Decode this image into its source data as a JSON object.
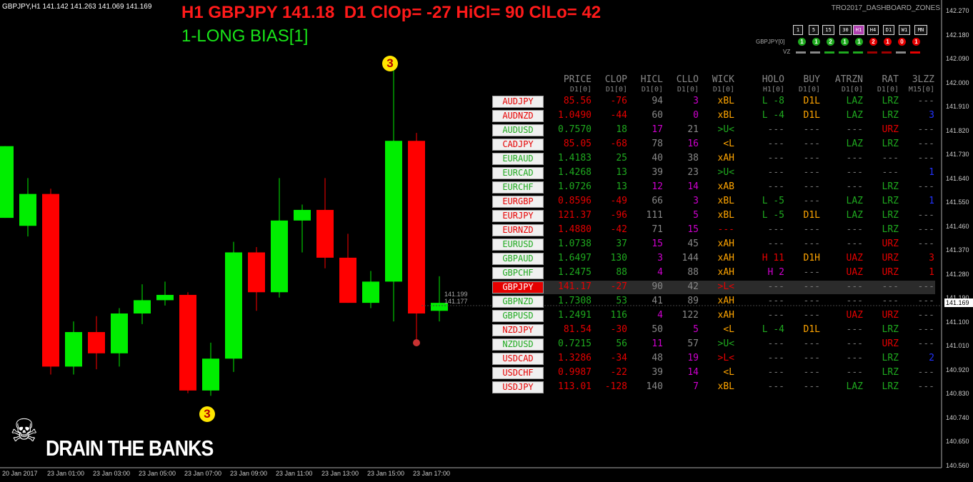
{
  "symbol_line": "GBPJPY,H1  141.142 141.263 141.069 141.169",
  "headline1": "H1 GBPJPY 141.18  D1 ClOp= -27 HiCl= 90 ClLo= 42",
  "headline2": "1-LONG BIAS[1]",
  "corner_label": "TRO2017_DASHBOARD_ZONES",
  "brand_text": "DRAIN THE BANKS",
  "skull_icon": "☠",
  "timeframes": [
    {
      "label": "1",
      "selected": false
    },
    {
      "label": "5",
      "selected": false
    },
    {
      "label": "15",
      "selected": false
    },
    {
      "label": "30",
      "selected": false
    },
    {
      "label": "H1",
      "selected": true
    },
    {
      "label": "H4",
      "selected": false
    },
    {
      "label": "D1",
      "selected": false
    },
    {
      "label": "W1",
      "selected": false
    },
    {
      "label": "MN",
      "selected": false
    }
  ],
  "tf_row_label": "GBPJPY[0]",
  "tf_circles": [
    {
      "v": "1",
      "c": "#1faa1f"
    },
    {
      "v": "1",
      "c": "#1faa1f"
    },
    {
      "v": "2",
      "c": "#1faa1f"
    },
    {
      "v": "1",
      "c": "#1faa1f"
    },
    {
      "v": "1",
      "c": "#1faa1f"
    },
    {
      "v": "2",
      "c": "#e60000"
    },
    {
      "v": "1",
      "c": "#e60000"
    },
    {
      "v": "0",
      "c": "#e60000"
    },
    {
      "v": "1",
      "c": "#e60000"
    }
  ],
  "vz_label": "VZ",
  "vz_colors": [
    "#888",
    "#888",
    "#1faa1f",
    "#1faa1f",
    "#1faa1f",
    "#a00000",
    "#a00000",
    "#888",
    "#e60000"
  ],
  "headers": [
    {
      "h": "PRICE",
      "s": "D1[0]"
    },
    {
      "h": "CLOP",
      "s": "D1[0]"
    },
    {
      "h": "HICL",
      "s": "D1[0]"
    },
    {
      "h": "CLLO",
      "s": "D1[0]"
    },
    {
      "h": "WICK",
      "s": "D1[0]"
    },
    {
      "h": "HOLO",
      "s": "H1[0]"
    },
    {
      "h": "BUY",
      "s": "D1[0]"
    },
    {
      "h": "ATRZN",
      "s": "D1[0]"
    },
    {
      "h": "RAT",
      "s": "D1[0]"
    },
    {
      "h": "3LZZ",
      "s": "M15[0]"
    }
  ],
  "rows": [
    {
      "pair": "AUDJPY",
      "pc": "#e60000",
      "price": "85.56",
      "clop": "-76",
      "hicl": "94",
      "cllo": "3",
      "wick": "xBL",
      "holo": "L -8",
      "buy": "D1L",
      "atr": "LAZ",
      "rat": "LRZ",
      "lzz": "---",
      "cc": [
        "#e60000",
        "#e60000",
        "#888",
        "#d000d0",
        "#ffa500",
        "#1faa1f",
        "#ffa500",
        "#1faa1f",
        "#1faa1f",
        "#777"
      ]
    },
    {
      "pair": "AUDNZD",
      "pc": "#e60000",
      "price": "1.0490",
      "clop": "-44",
      "hicl": "60",
      "cllo": "0",
      "wick": "xBL",
      "holo": "L -4",
      "buy": "D1L",
      "atr": "LAZ",
      "rat": "LRZ",
      "lzz": "3",
      "cc": [
        "#e60000",
        "#e60000",
        "#888",
        "#d000d0",
        "#ffa500",
        "#1faa1f",
        "#ffa500",
        "#1faa1f",
        "#1faa1f",
        "#2233ff"
      ]
    },
    {
      "pair": "AUDUSD",
      "pc": "#1faa1f",
      "price": "0.7570",
      "clop": "18",
      "hicl": "17",
      "cllo": "21",
      "wick": ">U<",
      "holo": "---",
      "buy": "---",
      "atr": "---",
      "rat": "URZ",
      "lzz": "---",
      "cc": [
        "#1faa1f",
        "#1faa1f",
        "#d000d0",
        "#888",
        "#1faa1f",
        "#777",
        "#777",
        "#777",
        "#e60000",
        "#777"
      ]
    },
    {
      "pair": "CADJPY",
      "pc": "#e60000",
      "price": "85.05",
      "clop": "-68",
      "hicl": "78",
      "cllo": "16",
      "wick": "<L",
      "holo": "---",
      "buy": "---",
      "atr": "LAZ",
      "rat": "LRZ",
      "lzz": "---",
      "cc": [
        "#e60000",
        "#e60000",
        "#888",
        "#d000d0",
        "#ffa500",
        "#777",
        "#777",
        "#1faa1f",
        "#1faa1f",
        "#777"
      ]
    },
    {
      "pair": "EURAUD",
      "pc": "#1faa1f",
      "price": "1.4183",
      "clop": "25",
      "hicl": "40",
      "cllo": "38",
      "wick": "xAH",
      "holo": "---",
      "buy": "---",
      "atr": "---",
      "rat": "---",
      "lzz": "---",
      "cc": [
        "#1faa1f",
        "#1faa1f",
        "#888",
        "#888",
        "#ffa500",
        "#777",
        "#777",
        "#777",
        "#777",
        "#777"
      ]
    },
    {
      "pair": "EURCAD",
      "pc": "#1faa1f",
      "price": "1.4268",
      "clop": "13",
      "hicl": "39",
      "cllo": "23",
      "wick": ">U<",
      "holo": "---",
      "buy": "---",
      "atr": "---",
      "rat": "---",
      "lzz": "1",
      "cc": [
        "#1faa1f",
        "#1faa1f",
        "#888",
        "#888",
        "#1faa1f",
        "#777",
        "#777",
        "#777",
        "#777",
        "#2233ff"
      ]
    },
    {
      "pair": "EURCHF",
      "pc": "#1faa1f",
      "price": "1.0726",
      "clop": "13",
      "hicl": "12",
      "cllo": "14",
      "wick": "xAB",
      "holo": "---",
      "buy": "---",
      "atr": "---",
      "rat": "LRZ",
      "lzz": "---",
      "cc": [
        "#1faa1f",
        "#1faa1f",
        "#d000d0",
        "#d000d0",
        "#ffa500",
        "#777",
        "#777",
        "#777",
        "#1faa1f",
        "#777"
      ]
    },
    {
      "pair": "EURGBP",
      "pc": "#e60000",
      "price": "0.8596",
      "clop": "-49",
      "hicl": "66",
      "cllo": "3",
      "wick": "xBL",
      "holo": "L -5",
      "buy": "---",
      "atr": "LAZ",
      "rat": "LRZ",
      "lzz": "1",
      "cc": [
        "#e60000",
        "#e60000",
        "#888",
        "#d000d0",
        "#ffa500",
        "#1faa1f",
        "#777",
        "#1faa1f",
        "#1faa1f",
        "#2233ff"
      ]
    },
    {
      "pair": "EURJPY",
      "pc": "#e60000",
      "price": "121.37",
      "clop": "-96",
      "hicl": "111",
      "cllo": "5",
      "wick": "xBL",
      "holo": "L -5",
      "buy": "D1L",
      "atr": "LAZ",
      "rat": "LRZ",
      "lzz": "---",
      "cc": [
        "#e60000",
        "#e60000",
        "#888",
        "#d000d0",
        "#ffa500",
        "#1faa1f",
        "#ffa500",
        "#1faa1f",
        "#1faa1f",
        "#777"
      ]
    },
    {
      "pair": "EURNZD",
      "pc": "#e60000",
      "price": "1.4880",
      "clop": "-42",
      "hicl": "71",
      "cllo": "15",
      "wick": "---",
      "holo": "---",
      "buy": "---",
      "atr": "---",
      "rat": "LRZ",
      "lzz": "---",
      "cc": [
        "#e60000",
        "#e60000",
        "#888",
        "#d000d0",
        "#e60000",
        "#777",
        "#777",
        "#777",
        "#1faa1f",
        "#777"
      ]
    },
    {
      "pair": "EURUSD",
      "pc": "#1faa1f",
      "price": "1.0738",
      "clop": "37",
      "hicl": "15",
      "cllo": "45",
      "wick": "xAH",
      "holo": "---",
      "buy": "---",
      "atr": "---",
      "rat": "URZ",
      "lzz": "---",
      "cc": [
        "#1faa1f",
        "#1faa1f",
        "#d000d0",
        "#888",
        "#ffa500",
        "#777",
        "#777",
        "#777",
        "#e60000",
        "#777"
      ]
    },
    {
      "pair": "GBPAUD",
      "pc": "#1faa1f",
      "price": "1.6497",
      "clop": "130",
      "hicl": "3",
      "cllo": "144",
      "wick": "xAH",
      "holo": "H 11",
      "buy": "D1H",
      "atr": "UAZ",
      "rat": "URZ",
      "lzz": "3",
      "cc": [
        "#1faa1f",
        "#1faa1f",
        "#d000d0",
        "#888",
        "#ffa500",
        "#e60000",
        "#ffa500",
        "#e60000",
        "#e60000",
        "#e60000"
      ]
    },
    {
      "pair": "GBPCHF",
      "pc": "#1faa1f",
      "price": "1.2475",
      "clop": "88",
      "hicl": "4",
      "cllo": "88",
      "wick": "xAH",
      "holo": "H 2",
      "buy": "---",
      "atr": "UAZ",
      "rat": "URZ",
      "lzz": "1",
      "cc": [
        "#1faa1f",
        "#1faa1f",
        "#d000d0",
        "#888",
        "#ffa500",
        "#d000d0",
        "#777",
        "#e60000",
        "#e60000",
        "#e60000"
      ]
    },
    {
      "pair": "GBPJPY",
      "pc": "#e60000",
      "price": "141.17",
      "clop": "-27",
      "hicl": "90",
      "cllo": "42",
      "wick": ">L<",
      "holo": "---",
      "buy": "---",
      "atr": "---",
      "rat": "---",
      "lzz": "---",
      "cc": [
        "#e60000",
        "#e60000",
        "#888",
        "#888",
        "#e60000",
        "#777",
        "#777",
        "#777",
        "#777",
        "#777"
      ]
    },
    {
      "pair": "GBPNZD",
      "pc": "#1faa1f",
      "price": "1.7308",
      "clop": "53",
      "hicl": "41",
      "cllo": "89",
      "wick": "xAH",
      "holo": "---",
      "buy": "---",
      "atr": "---",
      "rat": "---",
      "lzz": "---",
      "cc": [
        "#1faa1f",
        "#1faa1f",
        "#888",
        "#888",
        "#ffa500",
        "#777",
        "#777",
        "#777",
        "#777",
        "#777"
      ]
    },
    {
      "pair": "GBPUSD",
      "pc": "#1faa1f",
      "price": "1.2491",
      "clop": "116",
      "hicl": "4",
      "cllo": "122",
      "wick": "xAH",
      "holo": "---",
      "buy": "---",
      "atr": "UAZ",
      "rat": "URZ",
      "lzz": "---",
      "cc": [
        "#1faa1f",
        "#1faa1f",
        "#d000d0",
        "#888",
        "#ffa500",
        "#777",
        "#777",
        "#e60000",
        "#e60000",
        "#777"
      ]
    },
    {
      "pair": "NZDJPY",
      "pc": "#e60000",
      "price": "81.54",
      "clop": "-30",
      "hicl": "50",
      "cllo": "5",
      "wick": "<L",
      "holo": "L -4",
      "buy": "D1L",
      "atr": "---",
      "rat": "LRZ",
      "lzz": "---",
      "cc": [
        "#e60000",
        "#e60000",
        "#888",
        "#d000d0",
        "#ffa500",
        "#1faa1f",
        "#ffa500",
        "#777",
        "#1faa1f",
        "#777"
      ]
    },
    {
      "pair": "NZDUSD",
      "pc": "#1faa1f",
      "price": "0.7215",
      "clop": "56",
      "hicl": "11",
      "cllo": "57",
      "wick": ">U<",
      "holo": "---",
      "buy": "---",
      "atr": "---",
      "rat": "URZ",
      "lzz": "---",
      "cc": [
        "#1faa1f",
        "#1faa1f",
        "#d000d0",
        "#888",
        "#1faa1f",
        "#777",
        "#777",
        "#777",
        "#e60000",
        "#777"
      ]
    },
    {
      "pair": "USDCAD",
      "pc": "#e60000",
      "price": "1.3286",
      "clop": "-34",
      "hicl": "48",
      "cllo": "19",
      "wick": ">L<",
      "holo": "---",
      "buy": "---",
      "atr": "---",
      "rat": "LRZ",
      "lzz": "2",
      "cc": [
        "#e60000",
        "#e60000",
        "#888",
        "#d000d0",
        "#e60000",
        "#777",
        "#777",
        "#777",
        "#1faa1f",
        "#2233ff"
      ]
    },
    {
      "pair": "USDCHF",
      "pc": "#e60000",
      "price": "0.9987",
      "clop": "-22",
      "hicl": "39",
      "cllo": "14",
      "wick": "<L",
      "holo": "---",
      "buy": "---",
      "atr": "---",
      "rat": "LRZ",
      "lzz": "---",
      "cc": [
        "#e60000",
        "#e60000",
        "#888",
        "#d000d0",
        "#ffa500",
        "#777",
        "#777",
        "#777",
        "#1faa1f",
        "#777"
      ]
    },
    {
      "pair": "USDJPY",
      "pc": "#e60000",
      "price": "113.01",
      "clop": "-128",
      "hicl": "140",
      "cllo": "7",
      "wick": "xBL",
      "holo": "---",
      "buy": "---",
      "atr": "LAZ",
      "rat": "LRZ",
      "lzz": "---",
      "cc": [
        "#e60000",
        "#e60000",
        "#888",
        "#d000d0",
        "#ffa500",
        "#777",
        "#777",
        "#1faa1f",
        "#1faa1f",
        "#777"
      ]
    }
  ],
  "highlight_pair": "GBPJPY",
  "price_axis": [
    "142.270",
    "142.180",
    "142.090",
    "142.000",
    "141.910",
    "141.820",
    "141.730",
    "141.640",
    "141.550",
    "141.460",
    "141.370",
    "141.280",
    "141.190",
    "141.100",
    "141.010",
    "140.920",
    "140.830",
    "140.740",
    "140.650",
    "140.560"
  ],
  "current_price": "141.169",
  "bid_tag": "141.199",
  "ask_tag": "141.177",
  "time_axis": [
    "20 Jan 2017",
    "23 Jan 01:00",
    "23 Jan 03:00",
    "23 Jan 05:00",
    "23 Jan 07:00",
    "23 Jan 09:00",
    "23 Jan 11:00",
    "23 Jan 13:00",
    "23 Jan 15:00",
    "23 Jan 17:00"
  ],
  "badges": [
    {
      "label": "3"
    },
    {
      "label": "3"
    }
  ],
  "chart_data": {
    "type": "candlestick",
    "ylim": [
      140.56,
      142.27
    ],
    "candles": [
      {
        "o": 141.49,
        "h": 141.76,
        "l": 141.49,
        "c": 141.76
      },
      {
        "o": 141.46,
        "h": 141.64,
        "l": 141.42,
        "c": 141.58
      },
      {
        "o": 141.58,
        "h": 141.6,
        "l": 140.9,
        "c": 140.93
      },
      {
        "o": 140.93,
        "h": 141.1,
        "l": 140.9,
        "c": 141.06
      },
      {
        "o": 141.06,
        "h": 141.12,
        "l": 140.92,
        "c": 140.98
      },
      {
        "o": 140.98,
        "h": 141.15,
        "l": 140.93,
        "c": 141.13
      },
      {
        "o": 141.13,
        "h": 141.24,
        "l": 141.09,
        "c": 141.18
      },
      {
        "o": 141.18,
        "h": 141.25,
        "l": 141.16,
        "c": 141.2
      },
      {
        "o": 141.2,
        "h": 141.21,
        "l": 140.83,
        "c": 140.84
      },
      {
        "o": 140.84,
        "h": 141.02,
        "l": 140.82,
        "c": 140.96
      },
      {
        "o": 140.96,
        "h": 141.4,
        "l": 140.91,
        "c": 141.36
      },
      {
        "o": 141.36,
        "h": 141.38,
        "l": 141.14,
        "c": 141.21
      },
      {
        "o": 141.21,
        "h": 141.64,
        "l": 141.19,
        "c": 141.48
      },
      {
        "o": 141.48,
        "h": 141.54,
        "l": 141.36,
        "c": 141.52
      },
      {
        "o": 141.52,
        "h": 141.64,
        "l": 141.3,
        "c": 141.34
      },
      {
        "o": 141.34,
        "h": 141.43,
        "l": 141.17,
        "c": 141.17
      },
      {
        "o": 141.17,
        "h": 141.29,
        "l": 141.15,
        "c": 141.25
      },
      {
        "o": 141.25,
        "h": 142.09,
        "l": 141.1,
        "c": 141.78
      },
      {
        "o": 141.78,
        "h": 141.81,
        "l": 141.03,
        "c": 141.13
      },
      {
        "o": 141.14,
        "h": 141.27,
        "l": 141.1,
        "c": 141.17
      }
    ]
  }
}
